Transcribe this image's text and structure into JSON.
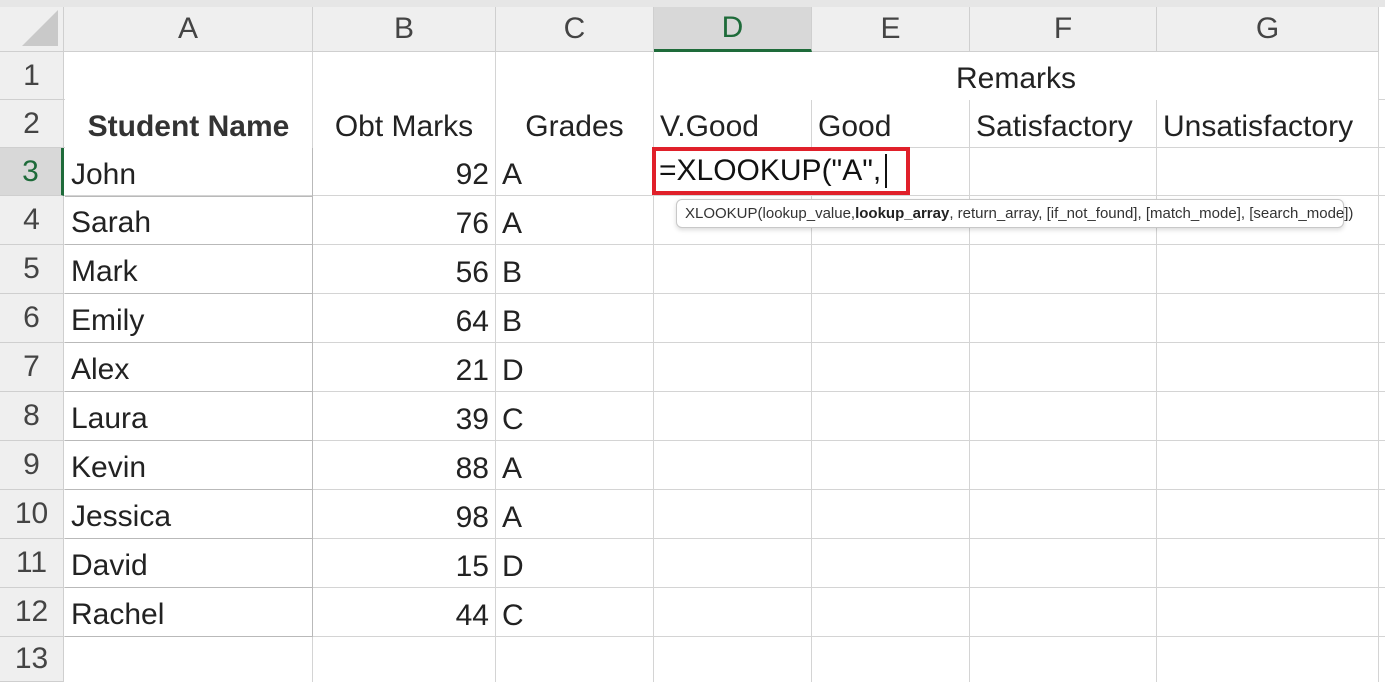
{
  "columns": [
    "A",
    "B",
    "C",
    "D",
    "E",
    "F",
    "G"
  ],
  "active_column": "D",
  "rows": [
    "1",
    "2",
    "3",
    "4",
    "5",
    "6",
    "7",
    "8",
    "9",
    "10",
    "11",
    "12",
    "13"
  ],
  "active_row": "3",
  "headers": {
    "remarks": "Remarks",
    "student_name": "Student Name",
    "obt_marks": "Obt Marks",
    "grades": "Grades",
    "v_good": "V.Good",
    "good": "Good",
    "satisfactory": "Satisfactory",
    "unsatisfactory": "Unsatisfactory"
  },
  "students": [
    {
      "name": "John",
      "marks": "92",
      "grade": "A"
    },
    {
      "name": "Sarah",
      "marks": "76",
      "grade": "A"
    },
    {
      "name": "Mark",
      "marks": "56",
      "grade": "B"
    },
    {
      "name": "Emily",
      "marks": "64",
      "grade": "B"
    },
    {
      "name": "Alex",
      "marks": "21",
      "grade": "D"
    },
    {
      "name": "Laura",
      "marks": "39",
      "grade": "C"
    },
    {
      "name": "Kevin",
      "marks": "88",
      "grade": "A"
    },
    {
      "name": "Jessica",
      "marks": "98",
      "grade": "A"
    },
    {
      "name": "David",
      "marks": "15",
      "grade": "D"
    },
    {
      "name": "Rachel",
      "marks": "44",
      "grade": "C"
    }
  ],
  "editing_cell": {
    "formula": "=XLOOKUP(\"A\","
  },
  "tooltip": {
    "prefix": "XLOOKUP(lookup_value, ",
    "current_arg": "lookup_array",
    "suffix": ", return_array, [if_not_found], [match_mode], [search_mode])"
  },
  "colors": {
    "active_header": "#1e6b3a",
    "edit_border": "#e0202a",
    "gridline": "#d4d4d4"
  }
}
